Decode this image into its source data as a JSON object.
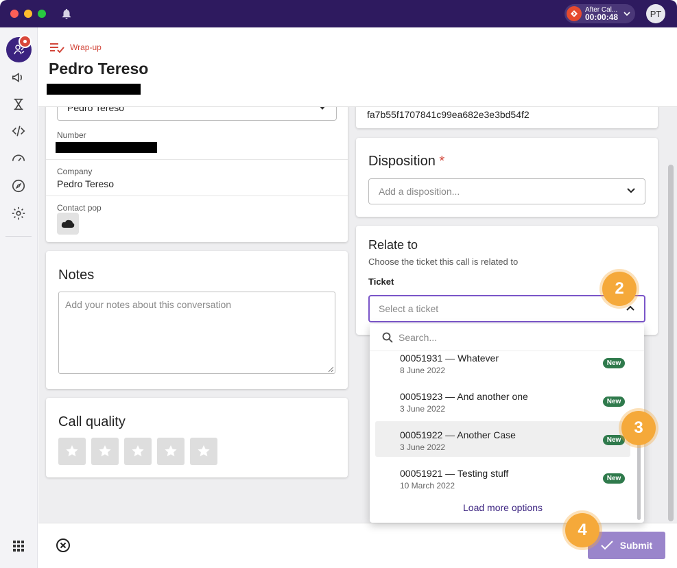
{
  "titlebar": {
    "after_call_label": "After Cal...",
    "after_call_timer": "00:00:48",
    "avatar_initials": "PT",
    "accent": "#2e1a5f"
  },
  "header": {
    "section_label": "Wrap-up",
    "contact_name": "Pedro Tereso"
  },
  "contact_card": {
    "selected_contact": "Pedro Tereso",
    "number_label": "Number",
    "company_label": "Company",
    "company_value": "Pedro Tereso",
    "contact_pop_label": "Contact pop"
  },
  "call_id": "fa7b55f1707841c99ea682e3e3bd54f2",
  "notes": {
    "title": "Notes",
    "placeholder": "Add your notes about this conversation"
  },
  "call_quality": {
    "title": "Call quality",
    "rating": 0,
    "max": 5
  },
  "disposition": {
    "title": "Disposition",
    "required_mark": "*",
    "placeholder": "Add a disposition..."
  },
  "relate": {
    "title": "Relate to",
    "subtitle": "Choose the ticket this call is related to",
    "ticket_label": "Ticket",
    "ticket_placeholder": "Select a ticket"
  },
  "dropdown": {
    "search_placeholder": "Search...",
    "options": [
      {
        "title": "00051931 — Whatever",
        "date": "8 June 2022",
        "badge": "New"
      },
      {
        "title": "00051923 — And another one",
        "date": "3 June 2022",
        "badge": "New"
      },
      {
        "title": "00051922 — Another Case",
        "date": "3 June 2022",
        "badge": "New"
      },
      {
        "title": "00051921 — Testing stuff",
        "date": "10 March 2022",
        "badge": "New"
      }
    ],
    "load_more": "Load more options"
  },
  "footer": {
    "submit_label": "Submit"
  },
  "steps": [
    "2",
    "3",
    "4"
  ]
}
